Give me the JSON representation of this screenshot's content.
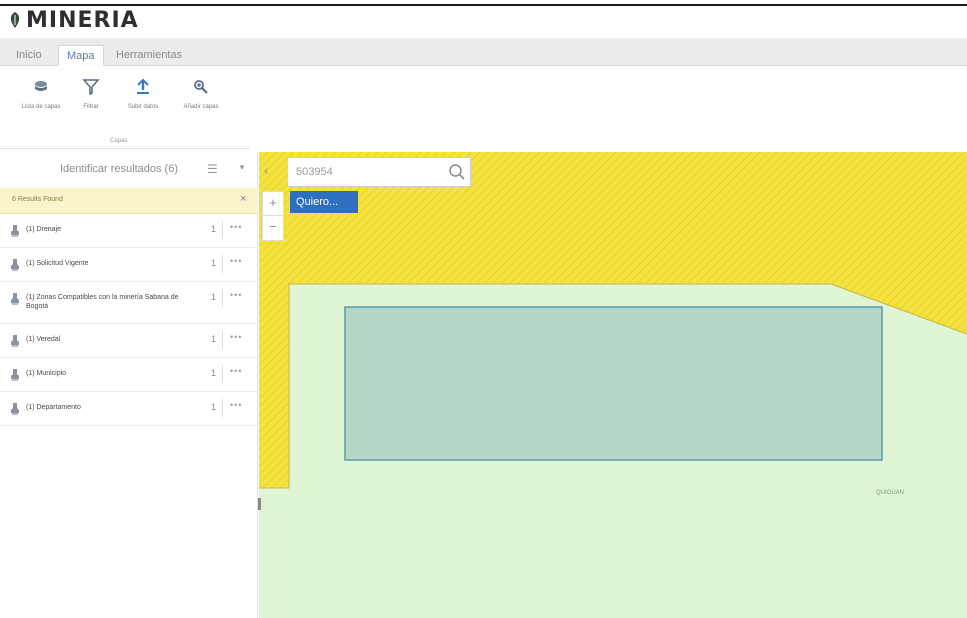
{
  "app": {
    "title": "MINERIA",
    "brand_color": "#2f2f2f",
    "logo_icon": "leaf-marker-icon"
  },
  "ribbon": {
    "tabs": [
      {
        "label": "Inicio",
        "active": false
      },
      {
        "label": "Mapa",
        "active": true
      },
      {
        "label": "Herramientas",
        "active": false
      }
    ],
    "buttons": [
      {
        "label": "Lista de capas",
        "icon": "layers-icon"
      },
      {
        "label": "Filtrar",
        "icon": "filter-icon"
      },
      {
        "label": "Subir datos",
        "icon": "upload-icon"
      },
      {
        "label": "Añadir capas",
        "icon": "add-layer-icon"
      }
    ],
    "group_label": "Capas"
  },
  "panel": {
    "title": "Identificar resultados (6)",
    "result_group": "6 Results Found",
    "layers": [
      {
        "name": "(1) Drenaje",
        "count": "1"
      },
      {
        "name": "(1) Solicitud Vigente",
        "count": "1"
      },
      {
        "name": "(1) Zonas Compatibles con la minería Sabana de Bogotá",
        "count": "1"
      },
      {
        "name": "(1) Veredal",
        "count": "1"
      },
      {
        "name": "(1) Municipio",
        "count": "1"
      },
      {
        "name": "(1) Departamento",
        "count": "1"
      }
    ]
  },
  "map": {
    "search": {
      "value": "503954",
      "placeholder": ""
    },
    "quiero_button": "Quiero...",
    "zoom_in": "+",
    "zoom_out": "−",
    "label": "QUIGUAN",
    "colors": {
      "yellow_area": "#f4e23f",
      "green_area": "#dff5d4",
      "selection_fill": "#b4d7c7",
      "selection_stroke": "#5a9bb1",
      "button_blue": "#2f6fbf"
    }
  }
}
